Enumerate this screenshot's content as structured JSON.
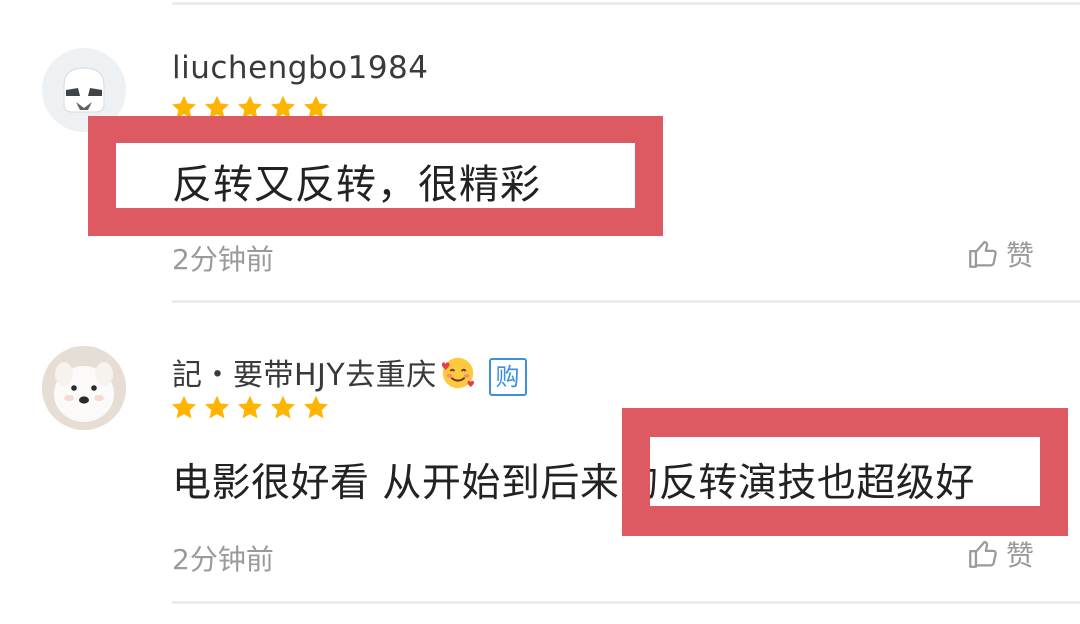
{
  "comments": [
    {
      "username": "liuchengbo1984",
      "avatar": "stormtrooper-avatar",
      "stars": 5,
      "text": "反转又反转，很精彩",
      "time": "2分钟前",
      "like_label": "赞"
    },
    {
      "username": "記・要带HJY去重庆",
      "avatar": "samoyed-dog-avatar",
      "badge": "购",
      "emoji": "smiling-face-with-hearts",
      "stars": 5,
      "text": "电影很好看 从开始到后来的反转演技也超级好",
      "time": "2分钟前",
      "like_label": "赞"
    }
  ],
  "colors": {
    "star": "#ffb400",
    "highlight_border": "#dd5a62",
    "badge": "#3c8ee0",
    "muted_text": "#9a9a9a"
  }
}
